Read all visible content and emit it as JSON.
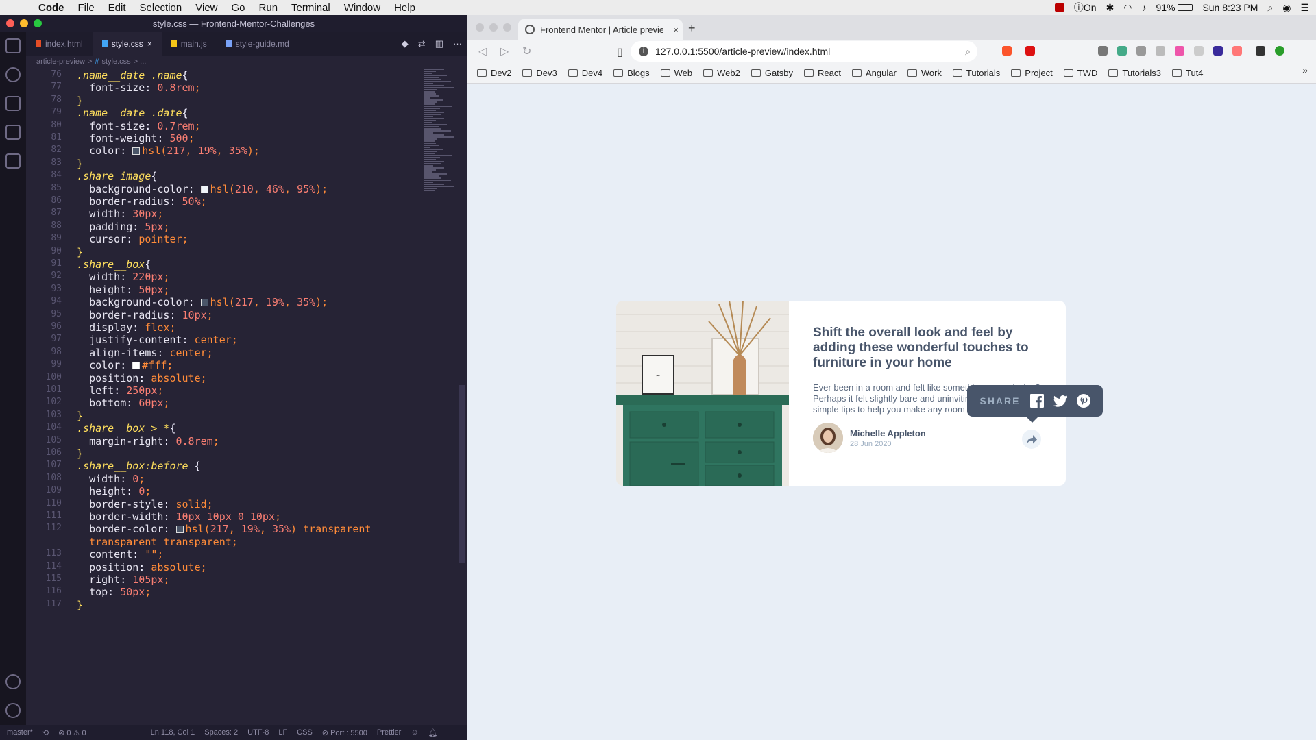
{
  "menubar": {
    "app": "Code",
    "items": [
      "File",
      "Edit",
      "Selection",
      "View",
      "Go",
      "Run",
      "Terminal",
      "Window",
      "Help"
    ],
    "vpn_label": "On",
    "battery": "91%",
    "clock": "Sun 8:23 PM"
  },
  "vscode": {
    "window_title": "style.css — Frontend-Mentor-Challenges",
    "tabs": [
      {
        "label": "index.html",
        "color": "#e44d26"
      },
      {
        "label": "style.css",
        "color": "#42a5f5",
        "active": true
      },
      {
        "label": "main.js",
        "color": "#f5c518"
      },
      {
        "label": "style-guide.md",
        "color": "#7aa2f7"
      }
    ],
    "breadcrumb": {
      "folder": "article-preview",
      "sep": ">",
      "file": "style.css",
      "more": "> ..."
    },
    "code_lines": [
      {
        "n": "76",
        "t": ".name__date .name{"
      },
      {
        "n": "77",
        "t": "  font-size: 0.8rem;"
      },
      {
        "n": "78",
        "t": "}"
      },
      {
        "n": "79",
        "t": ".name__date .date{"
      },
      {
        "n": "80",
        "t": "  font-size: 0.7rem;"
      },
      {
        "n": "81",
        "t": "  font-weight: 500;"
      },
      {
        "n": "82",
        "t": "  color: hsl(217, 19%, 35%);"
      },
      {
        "n": "83",
        "t": "}"
      },
      {
        "n": "84",
        "t": ".share_image{"
      },
      {
        "n": "85",
        "t": "  background-color: hsl(210, 46%, 95%);"
      },
      {
        "n": "86",
        "t": "  border-radius: 50%;"
      },
      {
        "n": "87",
        "t": "  width: 30px;"
      },
      {
        "n": "88",
        "t": "  padding: 5px;"
      },
      {
        "n": "89",
        "t": "  cursor: pointer;"
      },
      {
        "n": "90",
        "t": "}"
      },
      {
        "n": "91",
        "t": ".share__box{"
      },
      {
        "n": "92",
        "t": "  width: 220px;"
      },
      {
        "n": "93",
        "t": "  height: 50px;"
      },
      {
        "n": "94",
        "t": "  background-color: hsl(217, 19%, 35%);"
      },
      {
        "n": "95",
        "t": "  border-radius: 10px;"
      },
      {
        "n": "96",
        "t": "  display: flex;"
      },
      {
        "n": "97",
        "t": "  justify-content: center;"
      },
      {
        "n": "98",
        "t": "  align-items: center;"
      },
      {
        "n": "99",
        "t": "  color: #fff;"
      },
      {
        "n": "100",
        "t": "  position: absolute;"
      },
      {
        "n": "101",
        "t": "  left: 250px;"
      },
      {
        "n": "102",
        "t": "  bottom: 60px;"
      },
      {
        "n": "103",
        "t": "}"
      },
      {
        "n": "104",
        "t": ".share__box > *{"
      },
      {
        "n": "105",
        "t": "  margin-right: 0.8rem;"
      },
      {
        "n": "106",
        "t": "}"
      },
      {
        "n": "107",
        "t": ".share__box:before {"
      },
      {
        "n": "108",
        "t": "  width: 0;"
      },
      {
        "n": "109",
        "t": "  height: 0;"
      },
      {
        "n": "110",
        "t": "  border-style: solid;"
      },
      {
        "n": "111",
        "t": "  border-width: 10px 10px 0 10px;"
      },
      {
        "n": "112",
        "t": "  border-color: hsl(217, 19%, 35%) transparent"
      },
      {
        "n": "",
        "t": "  transparent transparent;"
      },
      {
        "n": "113",
        "t": "  content: \"\";"
      },
      {
        "n": "114",
        "t": "  position: absolute;"
      },
      {
        "n": "115",
        "t": "  right: 105px;"
      },
      {
        "n": "116",
        "t": "  top: 50px;"
      },
      {
        "n": "117",
        "t": "}"
      }
    ],
    "swatch_lines": {
      "82": "#4a5568",
      "85": "#eef3f8",
      "94": "#4a5568",
      "99": "#ffffff",
      "112": "#4a5568"
    },
    "status": {
      "branch": "master*",
      "errors": "⊗ 0 ⚠ 0",
      "cursor": "Ln 118, Col 1",
      "spaces": "Spaces: 2",
      "encoding": "UTF-8",
      "eol": "LF",
      "language": "CSS",
      "port": "⊘ Port : 5500",
      "formatter": "Prettier"
    }
  },
  "browser": {
    "tab_title": "Frontend Mentor | Article previe",
    "url": "127.0.0.1:5500/article-preview/index.html",
    "bookmarks": [
      "Dev2",
      "Dev3",
      "Dev4",
      "Blogs",
      "Web",
      "Web2",
      "Gatsby",
      "React",
      "Angular",
      "Work",
      "Tutorials",
      "Project",
      "TWD",
      "Tutorials3",
      "Tut4"
    ],
    "more": "»"
  },
  "card": {
    "title": "Shift the overall look and feel by adding these wonderful touches to furniture in your home",
    "description": "Ever been in a room and felt like something was missing? Perhaps it felt slightly bare and uninviting. I've got some simple tips to help you make any room feel complete.",
    "author_name": "Michelle Appleton",
    "author_date": "28 Jun 2020",
    "share_label": "SHARE"
  }
}
